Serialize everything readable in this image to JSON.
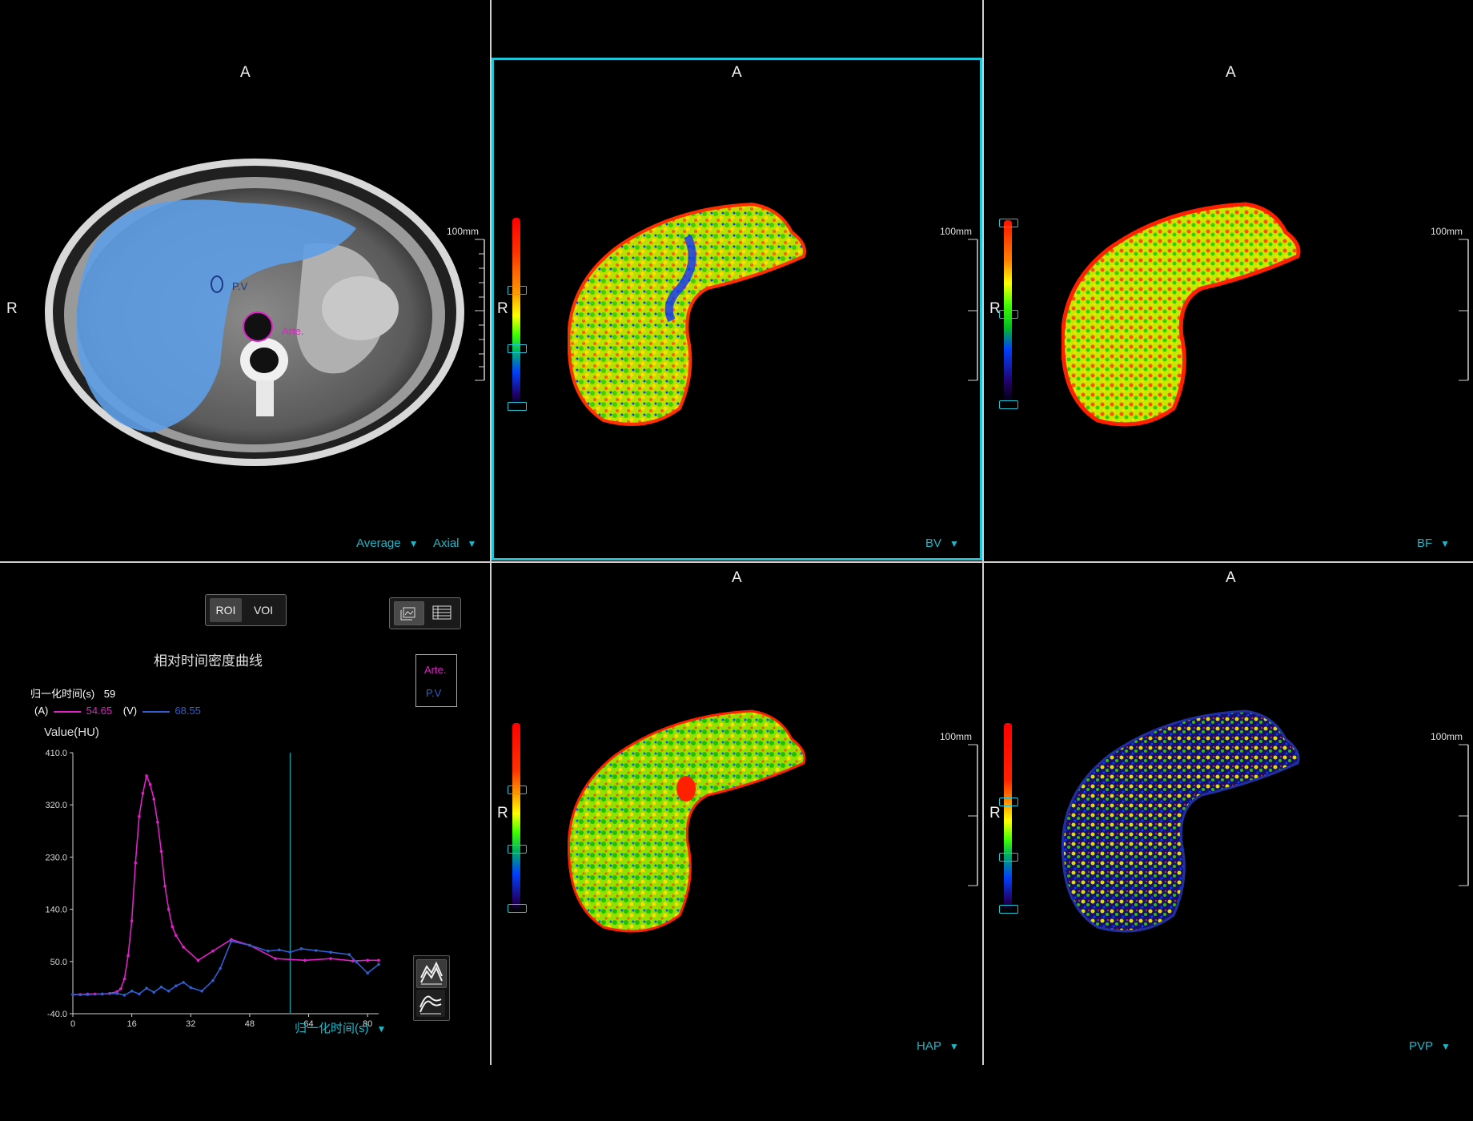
{
  "orientation": {
    "anterior": "A",
    "right": "R"
  },
  "scale": {
    "label": "100mm"
  },
  "panels": {
    "ct": {
      "avg_label": "Average",
      "view_label": "Axial",
      "roi_pv": "P.V",
      "roi_arte": "Arte."
    },
    "bv": {
      "map_label": "BV"
    },
    "bf": {
      "map_label": "BF"
    },
    "hap": {
      "map_label": "HAP"
    },
    "pvp": {
      "map_label": "PVP"
    }
  },
  "curve_panel": {
    "mode_buttons": [
      "ROI",
      "VOI"
    ],
    "active_mode": "ROI",
    "title": "相对时间密度曲线",
    "cursor_label": "归一化时间(s)",
    "cursor_value": "59",
    "a_label": "(A)",
    "a_value": "54.65",
    "v_label": "(V)",
    "v_value": "68.55",
    "legend": [
      "Arte.",
      "P.V"
    ],
    "x_axis_label": "归一化时间(s)"
  },
  "colors": {
    "accent": "#21c3d6",
    "arte": "#e020c8",
    "pv": "#2f5fd0"
  },
  "chart_data": {
    "type": "line",
    "ylabel": "Value(HU)",
    "xlabel": "归一化时间(s)",
    "xlim": [
      0,
      83
    ],
    "ylim": [
      -40,
      410
    ],
    "x_ticks": [
      0,
      16,
      32,
      48,
      64,
      80
    ],
    "y_ticks": [
      -40.0,
      50.0,
      140.0,
      230.0,
      320.0,
      410.0
    ],
    "y_tick_labels": [
      "-40.0",
      "50.0",
      "140.0",
      "230.0",
      "320.0",
      "410.0"
    ],
    "cursor_x": 59,
    "series": [
      {
        "name": "Arte.",
        "color": "#e020c8",
        "x": [
          0,
          2,
          4,
          6,
          8,
          10,
          12,
          13,
          14,
          15,
          16,
          17,
          18,
          19,
          20,
          21,
          22,
          23,
          24,
          25,
          26,
          27,
          28,
          30,
          34,
          38,
          43,
          48,
          55,
          63,
          70,
          76,
          80,
          83
        ],
        "y": [
          -7,
          -7,
          -6,
          -6,
          -6,
          -5,
          -2,
          3,
          20,
          60,
          120,
          220,
          300,
          340,
          370,
          355,
          330,
          290,
          240,
          180,
          140,
          110,
          95,
          75,
          52,
          68,
          88,
          78,
          55,
          52,
          55,
          51,
          52,
          52
        ]
      },
      {
        "name": "P.V",
        "color": "#2f5fd0",
        "x": [
          0,
          4,
          8,
          12,
          14,
          16,
          18,
          20,
          22,
          24,
          26,
          28,
          30,
          32,
          35,
          38,
          40,
          43,
          48,
          53,
          56,
          59,
          62,
          66,
          70,
          75,
          77,
          80,
          83
        ],
        "y": [
          -7,
          -7,
          -6,
          -5,
          -8,
          -1,
          -6,
          4,
          -3,
          6,
          -1,
          8,
          14,
          5,
          -1,
          17,
          38,
          85,
          78,
          68,
          70,
          66,
          72,
          69,
          66,
          62,
          49,
          30,
          45
        ]
      }
    ]
  }
}
